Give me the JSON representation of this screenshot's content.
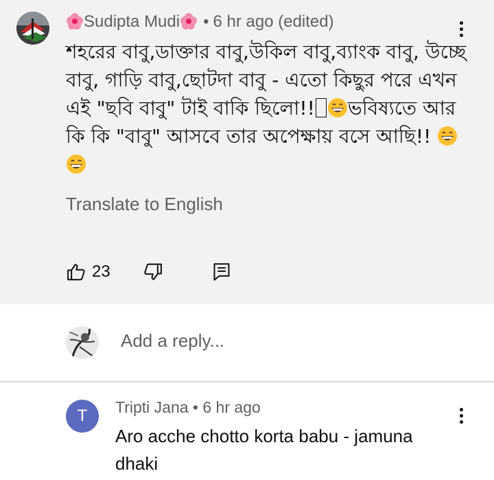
{
  "comment": {
    "author": "Sudipta Mudi",
    "meta": "6 hr ago (edited)",
    "separator": "•",
    "body_text": "শহরের বাবু,ডাক্তার বাবু,উকিল বাবু,ব্যাংক বাবু, উচ্ছে বাবু, গাড়ি বাবু,ছোটদা বাবু - এতো কিছুর পরে এখন এই \"ছবি বাবু\" টাই বাকি ছিলো!!",
    "body_text_2": "ভবিষ্যতে আর কি কি \"বাবু\" আসবে তার অপেক্ষায় বসে আছি!!",
    "translate_label": "Translate to English",
    "like_count": "23",
    "icons": {
      "avatar": "user-avatar-flag",
      "flower": "flower-emoji-icon",
      "menu": "more-vert-icon",
      "emoji": "grinning-face-emoji",
      "like": "thumb-up-icon",
      "dislike": "thumb-down-icon",
      "reply": "reply-comment-icon"
    }
  },
  "reply_input": {
    "placeholder": "Add a reply..."
  },
  "reply": {
    "avatar_letter": "T",
    "author": "Tripti Jana",
    "separator": "•",
    "time": "6 hr ago",
    "body_text": "Aro acche chotto korta babu - jamuna dhaki"
  },
  "colors": {
    "card_bg": "#f2f2f2",
    "secondary_text": "#606060",
    "primary_text": "#0f0f0f",
    "reply_avatar_bg": "#5c6bc0",
    "flower_pink": "#e91e63"
  }
}
